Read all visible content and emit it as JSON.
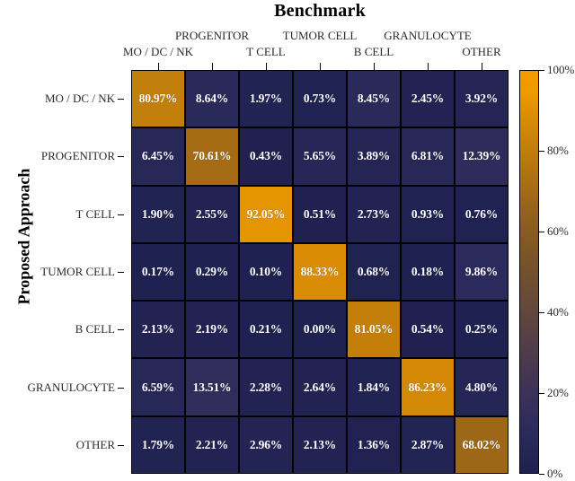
{
  "figure": {
    "title": "Benchmark",
    "xaxis_title": "Benchmark",
    "yaxis_title": "Proposed Approach"
  },
  "colorbar": {
    "ticks": [
      "100%",
      "80%",
      "60%",
      "40%",
      "20%",
      "0%"
    ],
    "tick_values": [
      100,
      80,
      60,
      40,
      20,
      0
    ],
    "low_color": "#1f2150",
    "mid_color": "#8a5a1f",
    "high_color": "#f59b01"
  },
  "chart_data": {
    "type": "heatmap",
    "title": "Benchmark",
    "xlabel": "Benchmark",
    "ylabel": "Proposed Approach",
    "categories": [
      "MO / DC / NK",
      "PROGENITOR",
      "T CELL",
      "TUMOR CELL",
      "B CELL",
      "GRANULOCYTE",
      "OTHER"
    ],
    "x_categories": [
      "MO / DC / NK",
      "PROGENITOR",
      "T CELL",
      "TUMOR CELL",
      "B CELL",
      "GRANULOCYTE",
      "OTHER"
    ],
    "y_categories": [
      "MO / DC / NK",
      "PROGENITOR",
      "T CELL",
      "TUMOR CELL",
      "B CELL",
      "GRANULOCYTE",
      "OTHER"
    ],
    "zlim": [
      0,
      100
    ],
    "unit": "%",
    "colorbar_ticks": [
      0,
      20,
      40,
      60,
      80,
      100
    ],
    "grid": false,
    "legend": "colorbar-right",
    "values": [
      [
        80.97,
        8.64,
        1.97,
        0.73,
        8.45,
        2.45,
        3.92
      ],
      [
        6.45,
        70.61,
        0.43,
        5.65,
        3.89,
        6.81,
        12.39
      ],
      [
        1.9,
        2.55,
        92.05,
        0.51,
        2.73,
        0.93,
        0.76
      ],
      [
        0.17,
        0.29,
        0.1,
        88.33,
        0.68,
        0.18,
        9.86
      ],
      [
        2.13,
        2.19,
        0.21,
        0.0,
        81.05,
        0.54,
        0.25
      ],
      [
        6.59,
        13.51,
        2.28,
        2.64,
        1.84,
        86.23,
        4.8
      ],
      [
        1.79,
        2.21,
        2.96,
        2.13,
        1.36,
        2.87,
        68.02
      ]
    ],
    "cell_labels": [
      [
        "80.97%",
        "8.64%",
        "1.97%",
        "0.73%",
        "8.45%",
        "2.45%",
        "3.92%"
      ],
      [
        "6.45%",
        "70.61%",
        "0.43%",
        "5.65%",
        "3.89%",
        "6.81%",
        "12.39%"
      ],
      [
        "1.90%",
        "2.55%",
        "92.05%",
        "0.51%",
        "2.73%",
        "0.93%",
        "0.76%"
      ],
      [
        "0.17%",
        "0.29%",
        "0.10%",
        "88.33%",
        "0.68%",
        "0.18%",
        "9.86%"
      ],
      [
        "2.13%",
        "2.19%",
        "0.21%",
        "0.00%",
        "81.05%",
        "0.54%",
        "0.25%"
      ],
      [
        "6.59%",
        "13.51%",
        "2.28%",
        "2.64%",
        "1.84%",
        "86.23%",
        "4.80%"
      ],
      [
        "1.79%",
        "2.21%",
        "2.96%",
        "2.13%",
        "1.36%",
        "2.87%",
        "68.02%"
      ]
    ]
  }
}
